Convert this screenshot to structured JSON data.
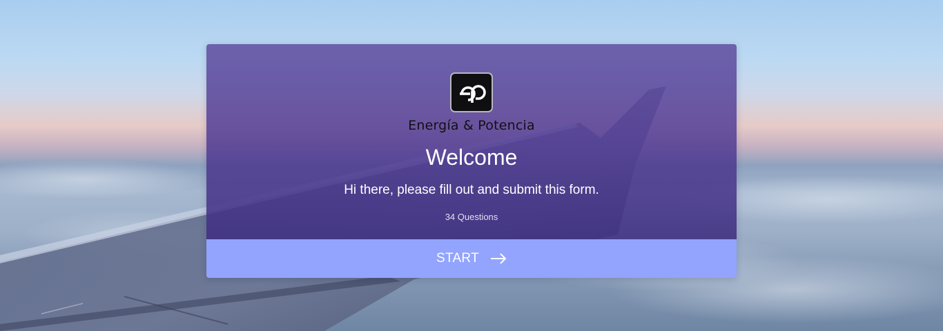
{
  "form": {
    "brand_name": "Energía & Potencia",
    "logo_text": "ep",
    "title": "Welcome",
    "subtitle": "Hi there, please fill out and submit this form.",
    "question_count": "34 Questions",
    "start_label": "START",
    "start_icon": "arrow-right-icon"
  },
  "colors": {
    "card_overlay": "#5c46a0",
    "start_button": "#92a4fd",
    "text": "#ffffff",
    "logo_background": "#0f0f12"
  }
}
